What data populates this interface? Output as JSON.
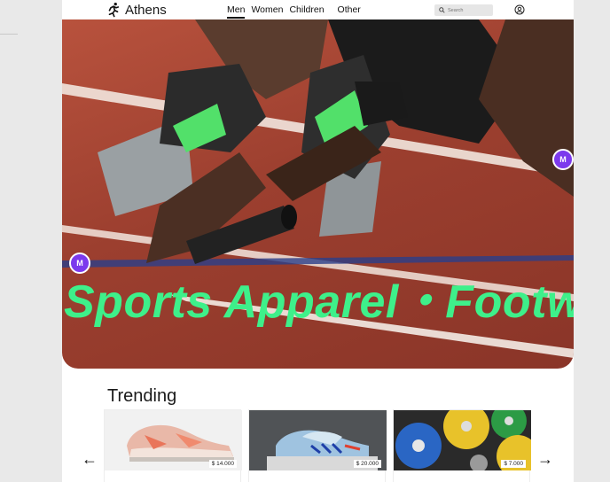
{
  "brand": {
    "name": "Athens",
    "logo_icon": "running-person-icon"
  },
  "nav": {
    "items": [
      {
        "label": "Men",
        "active": true
      },
      {
        "label": "Women",
        "active": false
      },
      {
        "label": "Children",
        "active": false
      },
      {
        "label": "Other",
        "active": false
      }
    ]
  },
  "search": {
    "placeholder": "Search",
    "icon": "search-icon"
  },
  "account": {
    "icon": "user-circle-icon"
  },
  "hero": {
    "headline": "Sports Apparel・Footwe",
    "badge_letter": "M",
    "headline_color": "#3ef08a",
    "badge_color": "#7c3aed"
  },
  "trending": {
    "title": "Trending",
    "prev_icon": "←",
    "next_icon": "→",
    "products": [
      {
        "price": "$ 14.000",
        "image": "pink-sneaker"
      },
      {
        "price": "$ 20.000",
        "image": "blue-football-boots"
      },
      {
        "price": "$ 7.000",
        "image": "weight-plates"
      }
    ]
  }
}
